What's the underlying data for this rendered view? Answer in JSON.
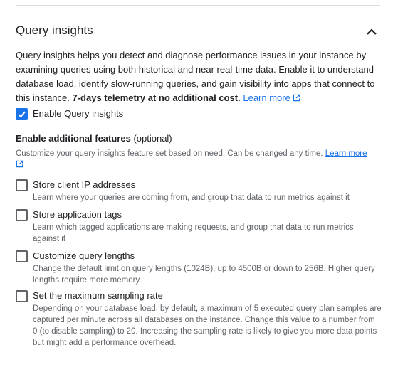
{
  "section": {
    "title": "Query insights",
    "desc_main": "Query insights helps you detect and diagnose performance issues in your instance by examining queries using both historical and near real-time data. Enable it to understand database load, identify slow-running queries, and gain visibility into apps that connect to this instance. ",
    "desc_bold": "7-days telemetry at no additional cost.",
    "learn_more": "Learn more"
  },
  "enable": {
    "label": "Enable Query insights",
    "checked": true
  },
  "additional": {
    "heading": "Enable additional features",
    "optional": " (optional)",
    "subtext": "Customize your query insights feature set based on need. Can be changed any time.",
    "learn_more": "Learn more"
  },
  "options": [
    {
      "label": "Store client IP addresses",
      "desc": "Learn where your queries are coming from, and group that data to run metrics against it",
      "checked": false
    },
    {
      "label": "Store application tags",
      "desc": "Learn which tagged applications are making requests, and group that data to run metrics against it",
      "checked": false
    },
    {
      "label": "Customize query lengths",
      "desc": "Change the default limit on query lengths (1024B), up to 4500B or down to 256B. Higher query lengths require more memory.",
      "checked": false
    },
    {
      "label": "Set the maximum sampling rate",
      "desc": "Depending on your database load, by default, a maximum of 5 executed query plan samples are captured per minute across all databases on the instance. Change this value to a number from 0 (to disable sampling) to 20. Increasing the sampling rate is likely to give you more data points but might add a performance overhead.",
      "checked": false
    }
  ],
  "colors": {
    "accent": "#1a73e8",
    "text": "#202124",
    "muted": "#5f6368",
    "divider": "#dadce0"
  },
  "icons": {
    "collapse": "chevron-up-icon",
    "external": "external-link-icon",
    "check": "check-icon"
  }
}
